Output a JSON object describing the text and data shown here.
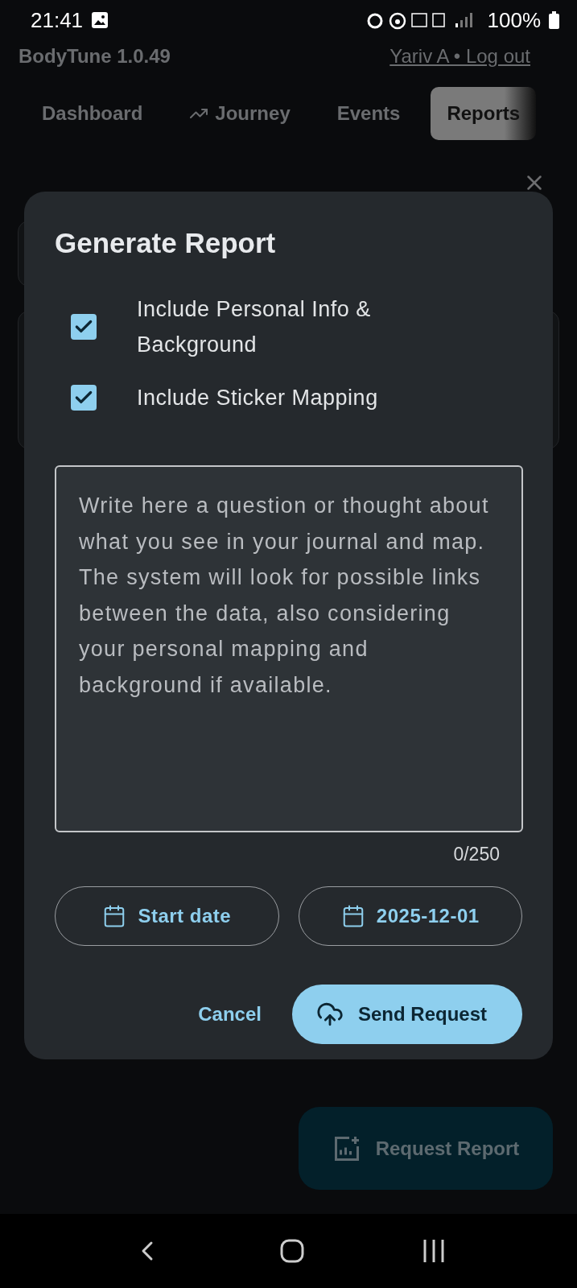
{
  "status_bar": {
    "time": "21:41",
    "battery": "100%"
  },
  "header": {
    "app_version": "BodyTune 1.0.49",
    "account_link": "Yariv A • Log out"
  },
  "tabs": [
    {
      "label": "Dashboard",
      "selected": false,
      "kind": "plain"
    },
    {
      "label": "Journey",
      "selected": false,
      "kind": "with-icon"
    },
    {
      "label": "Events",
      "selected": false,
      "kind": "plain"
    },
    {
      "label": "Reports",
      "selected": true,
      "kind": "plain"
    }
  ],
  "dialog": {
    "title": "Generate Report",
    "options": [
      {
        "label": "Include Personal Info & Background",
        "checked": true
      },
      {
        "label": "Include Sticker Mapping",
        "checked": true
      }
    ],
    "question": {
      "placeholder": "Write here a question or thought about what you see in your journal and map. The system will look for possible links between the data, also considering your personal mapping and background if available.",
      "counter": "0/250"
    },
    "dates": [
      {
        "label": "Start date"
      },
      {
        "label": "2025-12-01"
      }
    ],
    "actions": [
      {
        "label": "Cancel",
        "kind": "text"
      },
      {
        "label": "Send Request",
        "kind": "filled"
      }
    ]
  },
  "fab": {
    "label": "Request Report"
  }
}
